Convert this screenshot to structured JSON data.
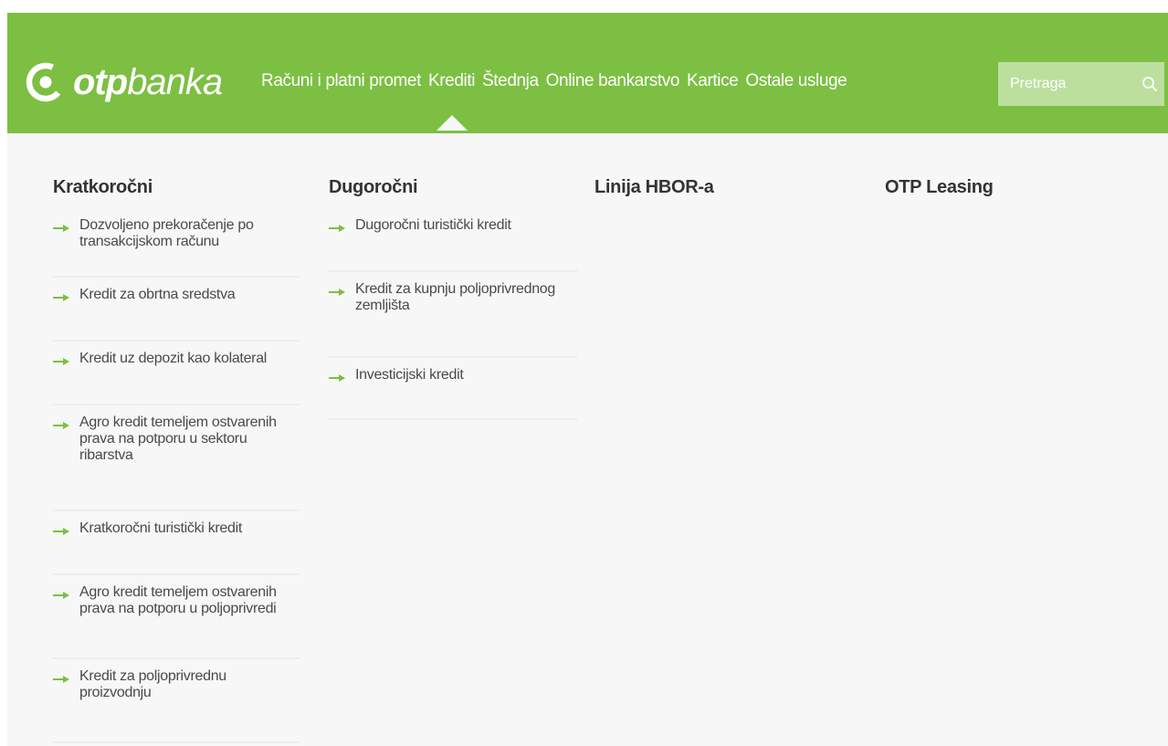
{
  "header": {
    "logo_mark_name": "otp-logo-icon",
    "logo_part1": "otp",
    "logo_part2": "banka",
    "nav": [
      {
        "label": "Računi i platni promet",
        "active": false
      },
      {
        "label": "Krediti",
        "active": true
      },
      {
        "label": "Štednja",
        "active": false
      },
      {
        "label": "Online bankarstvo",
        "active": false
      },
      {
        "label": "Kartice",
        "active": false
      },
      {
        "label": "Ostale usluge",
        "active": false
      }
    ],
    "search": {
      "placeholder": "Pretraga",
      "value": "",
      "icon": "search-icon"
    }
  },
  "menu": {
    "columns": [
      {
        "title": "Kratkoročni",
        "items": [
          {
            "lines": [
              "Dozvoljeno prekoračenje po",
              "transakcijskom računu"
            ]
          },
          {
            "lines": [
              "Kredit za obrtna sredstva"
            ]
          },
          {
            "lines": [
              "Kredit uz depozit kao kolateral"
            ]
          },
          {
            "lines": [
              "Agro kredit temeljem ostvarenih",
              "prava na potporu u sektoru",
              "ribarstva"
            ]
          },
          {
            "lines": [
              "Kratkoročni turistički kredit"
            ]
          },
          {
            "lines": [
              "Agro kredit temeljem ostvarenih",
              "prava na potporu u poljoprivredi"
            ]
          },
          {
            "lines": [
              "Kredit za poljoprivrednu",
              "proizvodnju"
            ]
          }
        ]
      },
      {
        "title": "Dugoročni",
        "items": [
          {
            "lines": [
              "Dugoročni turistički kredit"
            ]
          },
          {
            "lines": [
              "Kredit za kupnju poljoprivrednog",
              "zemljišta"
            ]
          },
          {
            "lines": [
              "Investicijski kredit"
            ]
          }
        ]
      },
      {
        "title": "Linija HBOR-a",
        "items": []
      },
      {
        "title": "OTP Leasing",
        "items": []
      }
    ]
  },
  "colors": {
    "brand_green": "#7cbf42",
    "search_bg": "#bcdf9e",
    "arrow_green": "#7cbf42",
    "text": "#4a4a4a",
    "heading": "#333333"
  }
}
